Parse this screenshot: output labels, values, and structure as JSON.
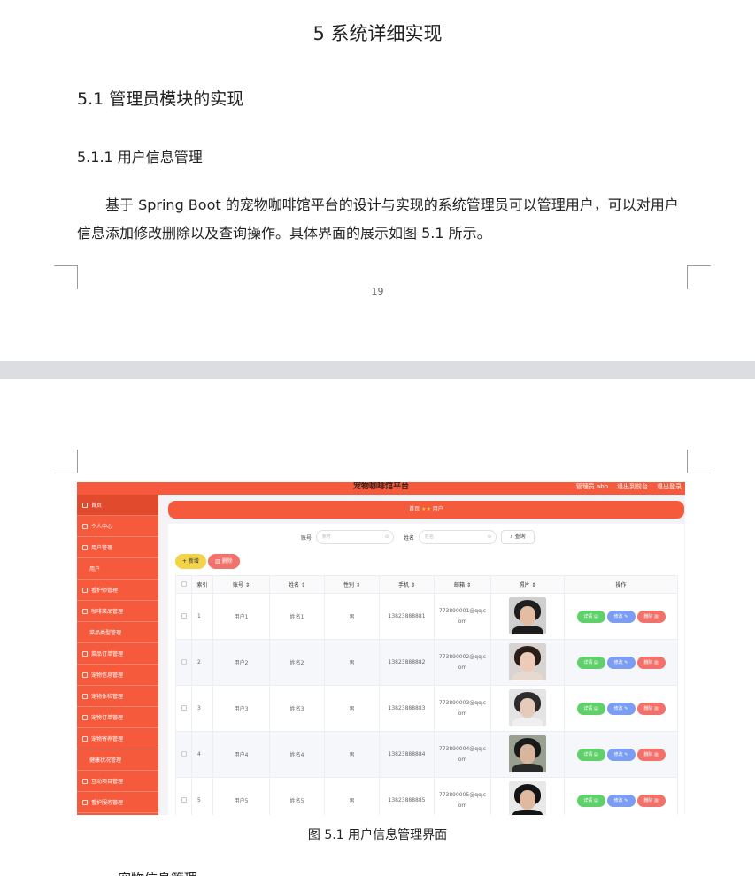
{
  "page1": {
    "chapter_title": "5 系统详细实现",
    "section_heading": "5.1  管理员模块的实现",
    "subsection_heading": "5.1.1  用户信息管理",
    "paragraph": "基于 Spring Boot 的宠物咖啡馆平台的设计与实现的系统管理员可以管理用户，可以对用户信息添加修改删除以及查询操作。具体界面的展示如图 5.1 所示。",
    "page_number": "19"
  },
  "figure": {
    "caption": "图 5.1  用户信息管理界面"
  },
  "next_heading": "宠物信息管理",
  "app": {
    "brand": "宠物咖啡馆平台",
    "header_links": [
      "管理员 abo",
      "退出到前台",
      "退出登录"
    ],
    "sidebar": [
      {
        "label": "首页",
        "sub": false,
        "icon": true
      },
      {
        "label": "个人中心",
        "sub": false,
        "icon": true
      },
      {
        "label": "用户管理",
        "sub": false,
        "icon": true
      },
      {
        "label": "用户",
        "sub": true,
        "icon": false
      },
      {
        "label": "看护师管理",
        "sub": false,
        "icon": true
      },
      {
        "label": "咖啡菜品管理",
        "sub": false,
        "icon": true
      },
      {
        "label": "菜品类型管理",
        "sub": true,
        "icon": false
      },
      {
        "label": "菜品订单管理",
        "sub": false,
        "icon": true
      },
      {
        "label": "宠物信息管理",
        "sub": false,
        "icon": true
      },
      {
        "label": "宠物体检管理",
        "sub": false,
        "icon": true
      },
      {
        "label": "宠物订单管理",
        "sub": false,
        "icon": true
      },
      {
        "label": "宠物寄养管理",
        "sub": false,
        "icon": true
      },
      {
        "label": "健康状况管理",
        "sub": true,
        "icon": false
      },
      {
        "label": "互动项目管理",
        "sub": false,
        "icon": true
      },
      {
        "label": "看护服务管理",
        "sub": false,
        "icon": true
      }
    ],
    "breadcrumb": {
      "home": "首页",
      "current": "用户"
    },
    "search": {
      "account_label": "账号",
      "account_placeholder": "账号",
      "name_label": "姓名",
      "name_placeholder": "姓名",
      "button": "查询"
    },
    "add_button": "+ 新增",
    "delete_button": "删除",
    "table": {
      "headers": [
        "索引",
        "账号",
        "姓名",
        "性别",
        "手机",
        "邮箱",
        "照片",
        "操作"
      ],
      "rows": [
        {
          "index": "1",
          "account": "用户1",
          "name": "姓名1",
          "gender": "男",
          "phone": "13823888881",
          "email": "773890001@qq.com"
        },
        {
          "index": "2",
          "account": "用户2",
          "name": "姓名2",
          "gender": "男",
          "phone": "13823888882",
          "email": "773890002@qq.com"
        },
        {
          "index": "3",
          "account": "用户3",
          "name": "姓名3",
          "gender": "男",
          "phone": "13823888883",
          "email": "773890003@qq.com"
        },
        {
          "index": "4",
          "account": "用户4",
          "name": "姓名4",
          "gender": "男",
          "phone": "13823888884",
          "email": "773890004@qq.com"
        },
        {
          "index": "5",
          "account": "用户5",
          "name": "姓名5",
          "gender": "男",
          "phone": "13823888885",
          "email": "773890005@qq.com"
        }
      ],
      "row_actions": [
        "详情",
        "修改",
        "删除"
      ]
    }
  },
  "colors": {
    "primary": "#f55a3d",
    "add": "#f2d34a",
    "danger": "#f2716a",
    "success": "#5fd06a",
    "edit": "#7c9ef2"
  }
}
